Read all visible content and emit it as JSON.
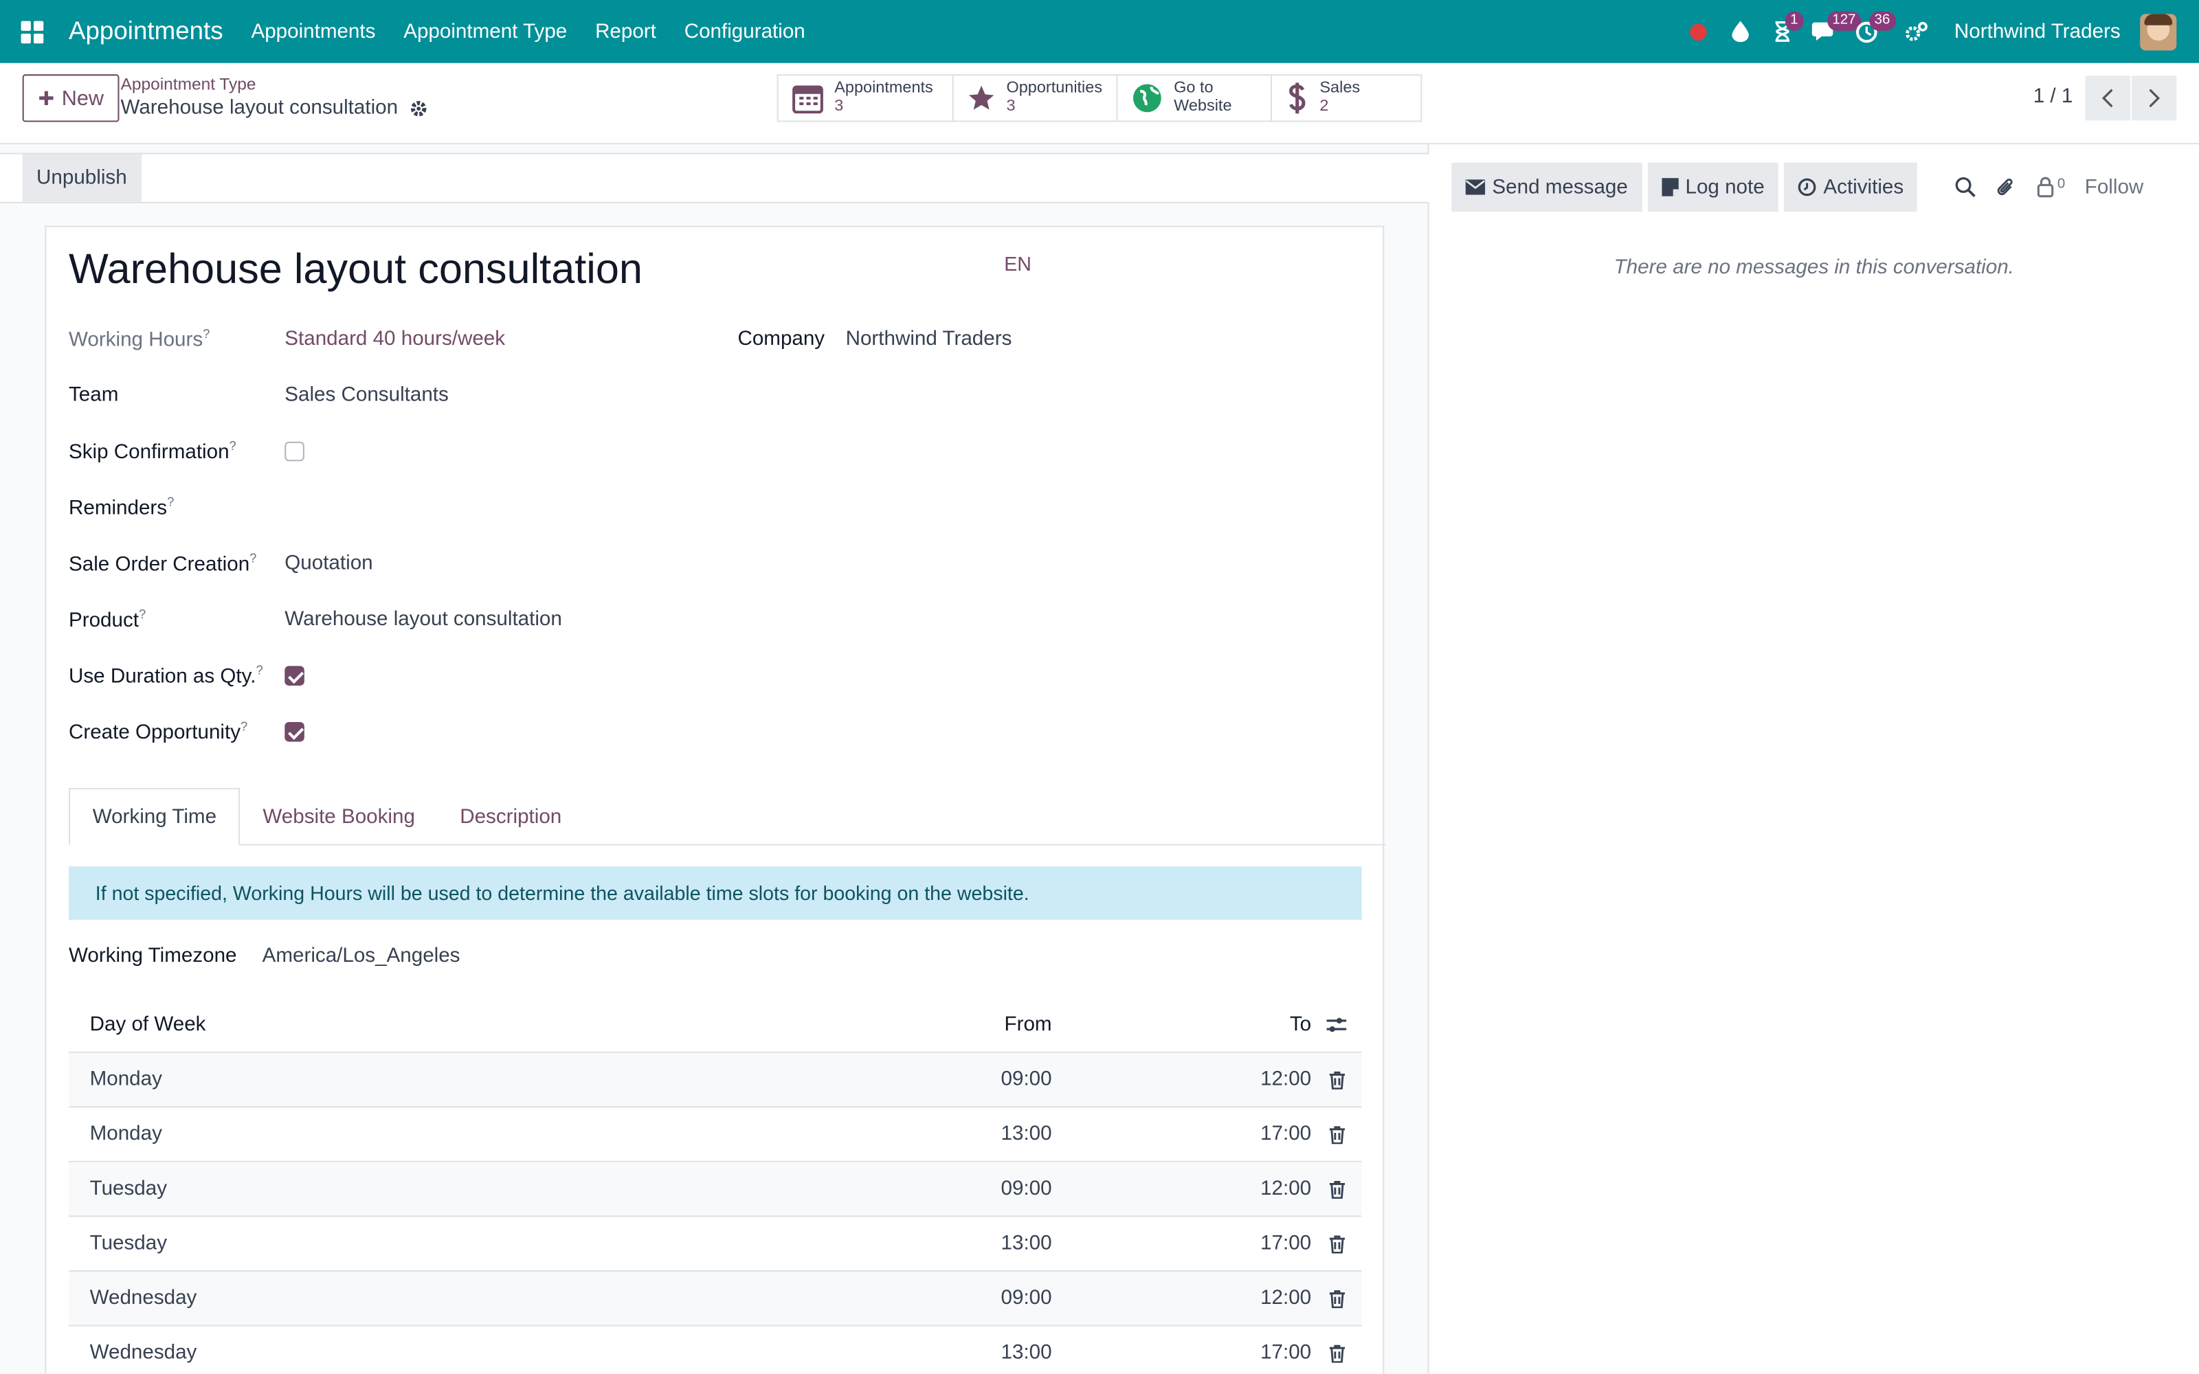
{
  "topbar": {
    "app_name": "Appointments",
    "menu": [
      "Appointments",
      "Appointment Type",
      "Report",
      "Configuration"
    ],
    "badges": {
      "activities": "1",
      "messages": "127",
      "clock": "36"
    },
    "company": "Northwind Traders"
  },
  "control": {
    "new_label": "New",
    "breadcrumb_parent": "Appointment Type",
    "breadcrumb_current": "Warehouse layout consultation",
    "smart_buttons": [
      {
        "line1": "Appointments",
        "line2": "3"
      },
      {
        "line1": "Opportunities",
        "line2": "3"
      },
      {
        "line1": "Go to",
        "line2": "Website"
      },
      {
        "line1": "Sales",
        "line2": "2"
      }
    ],
    "pager": "1 / 1"
  },
  "status": {
    "unpublish_label": "Unpublish"
  },
  "form": {
    "title": "Warehouse layout consultation",
    "lang": "EN",
    "working_hours_label": "Working Hours",
    "working_hours_value": "Standard 40 hours/week",
    "company_label": "Company",
    "company_value": "Northwind Traders",
    "team_label": "Team",
    "team_value": "Sales Consultants",
    "skip_confirmation_label": "Skip Confirmation",
    "skip_confirmation_checked": false,
    "reminders_label": "Reminders",
    "sale_order_label": "Sale Order Creation",
    "sale_order_value": "Quotation",
    "product_label": "Product",
    "product_value": "Warehouse layout consultation",
    "use_duration_label": "Use Duration as Qty.",
    "use_duration_checked": true,
    "create_opportunity_label": "Create Opportunity",
    "create_opportunity_checked": true,
    "help_mark": "?"
  },
  "tabs": [
    "Working Time",
    "Website Booking",
    "Description"
  ],
  "working_time": {
    "alert": "If not specified, Working Hours will be used to determine the available time slots for booking on the website.",
    "tz_label": "Working Timezone",
    "tz_value": "America/Los_Angeles",
    "columns": {
      "day": "Day of Week",
      "from": "From",
      "to": "To"
    },
    "rows": [
      {
        "day": "Monday",
        "from": "09:00",
        "to": "12:00"
      },
      {
        "day": "Monday",
        "from": "13:00",
        "to": "17:00"
      },
      {
        "day": "Tuesday",
        "from": "09:00",
        "to": "12:00"
      },
      {
        "day": "Tuesday",
        "from": "13:00",
        "to": "17:00"
      },
      {
        "day": "Wednesday",
        "from": "09:00",
        "to": "12:00"
      },
      {
        "day": "Wednesday",
        "from": "13:00",
        "to": "17:00"
      }
    ]
  },
  "chatter": {
    "send_message": "Send message",
    "log_note": "Log note",
    "activities": "Activities",
    "followers_count": "0",
    "follow": "Follow",
    "empty": "There are no messages in this conversation."
  },
  "colors": {
    "brand": "#018f98",
    "accent": "#714b67",
    "status_dot": "#e03c3c"
  }
}
